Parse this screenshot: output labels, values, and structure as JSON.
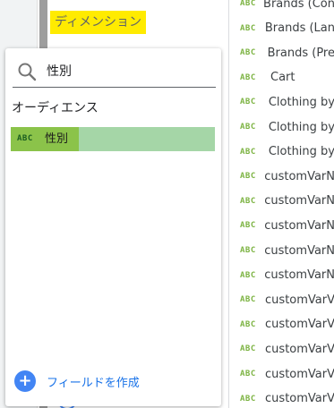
{
  "background": {
    "dimension_label": "ディメンション"
  },
  "field_list": {
    "type_badge": "ABC",
    "items": [
      "Brands (Con",
      "Brands (Lan",
      "Brands (Pre",
      "Cart",
      "Clothing by",
      "Clothing by",
      "Clothing by",
      "customVarN",
      "customVarN",
      "customVarN",
      "customVarN",
      "customVarN",
      "customVarV",
      "customVarV",
      "customVarV",
      "customVarV",
      "customVarV"
    ]
  },
  "popup": {
    "search": {
      "value": "性別",
      "icon": "search-icon"
    },
    "section_title": "オーディエンス",
    "result": {
      "badge": "ABC",
      "label": "性別"
    },
    "create_field": {
      "icon": "plus-icon",
      "label": "フィールドを作成"
    }
  },
  "colors": {
    "highlight_yellow": "#ffeb00",
    "result_row": "#a5d6a7",
    "result_match": "#8bc34a",
    "accent_blue": "#4285f4",
    "badge_green": "#7cb342"
  }
}
